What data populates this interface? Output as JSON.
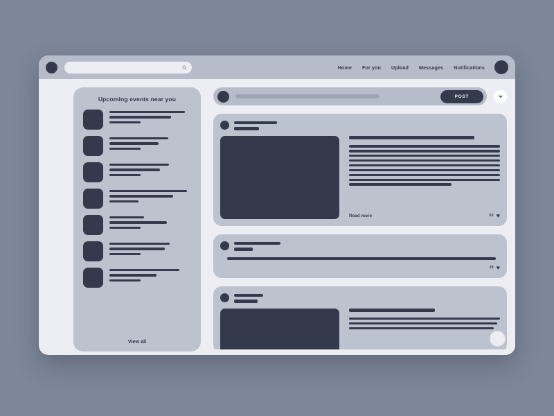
{
  "theme": {
    "page_bg": "#7d8799",
    "window_bg": "#eceef3",
    "topbar_bg": "#b6bcc9",
    "card_bg": "#bcc2ce",
    "ink": "#343a4c",
    "accent": "#343a4c"
  },
  "topbar": {
    "search": {
      "placeholder": "",
      "value": "",
      "icon": "search-icon"
    },
    "nav": [
      {
        "label": "Home"
      },
      {
        "label": "For you"
      },
      {
        "label": "Upload"
      },
      {
        "label": "Messages"
      },
      {
        "label": "Notifications"
      }
    ]
  },
  "sidebar": {
    "title": "Upcoming events near you",
    "view_all": "View all",
    "events": [
      {
        "lines": [
          92,
          75,
          38
        ]
      },
      {
        "lines": [
          72,
          60,
          38
        ]
      },
      {
        "lines": [
          73,
          62,
          38
        ]
      },
      {
        "lines": [
          95,
          78,
          36
        ]
      },
      {
        "lines": [
          42,
          70,
          38
        ]
      },
      {
        "lines": [
          74,
          68,
          38
        ]
      },
      {
        "lines": [
          86,
          58,
          38
        ]
      }
    ]
  },
  "composer": {
    "placeholder": "",
    "post_label": "POST",
    "expand_icon": "chevron-down-icon"
  },
  "feed": {
    "posts": [
      {
        "type": "media-left",
        "head_lines": [
          62,
          36
        ],
        "text_lead": 83,
        "text_lines": [
          100,
          100,
          100,
          100,
          100,
          100,
          100,
          100,
          68
        ],
        "read_more": "Read more",
        "like_count": "63"
      },
      {
        "type": "compact",
        "head_lines": [
          67,
          27
        ],
        "body_line": 96,
        "like_count": "29"
      },
      {
        "type": "media-left-clipped",
        "head_lines": [
          42,
          34
        ],
        "text_lead": 57,
        "text_lines": [
          100,
          98,
          96
        ]
      }
    ]
  }
}
